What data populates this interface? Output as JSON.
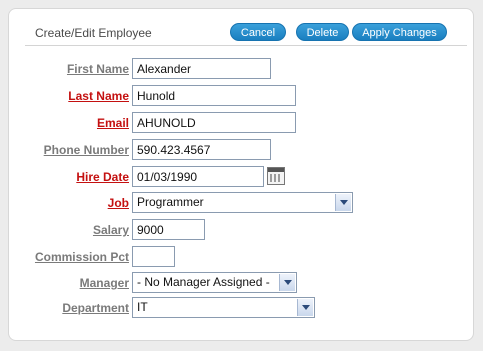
{
  "region": {
    "title": "Create/Edit Employee",
    "buttons": {
      "cancel": "Cancel",
      "delete": "Delete",
      "apply": "Apply Changes"
    }
  },
  "form": {
    "first_name": {
      "label": "First Name",
      "value": "Alexander",
      "required": false
    },
    "last_name": {
      "label": "Last Name",
      "value": "Hunold",
      "required": true
    },
    "email": {
      "label": "Email",
      "value": "AHUNOLD",
      "required": true
    },
    "phone": {
      "label": "Phone Number",
      "value": "590.423.4567",
      "required": false
    },
    "hire_date": {
      "label": "Hire Date",
      "value": "01/03/1990",
      "required": true
    },
    "job": {
      "label": "Job",
      "value": "Programmer",
      "required": true
    },
    "salary": {
      "label": "Salary",
      "value": "9000",
      "required": false
    },
    "commission": {
      "label": "Commission Pct",
      "value": "",
      "required": false
    },
    "manager": {
      "label": "Manager",
      "value": "- No Manager Assigned -",
      "required": false
    },
    "department": {
      "label": "Department",
      "value": "IT",
      "required": false
    }
  },
  "colors": {
    "button": "#2a90d0",
    "required_label": "#c41010",
    "optional_label": "#7a7a7a"
  },
  "icons": {
    "calendar": "calendar-icon",
    "dropdown": "chevron-down-icon"
  }
}
